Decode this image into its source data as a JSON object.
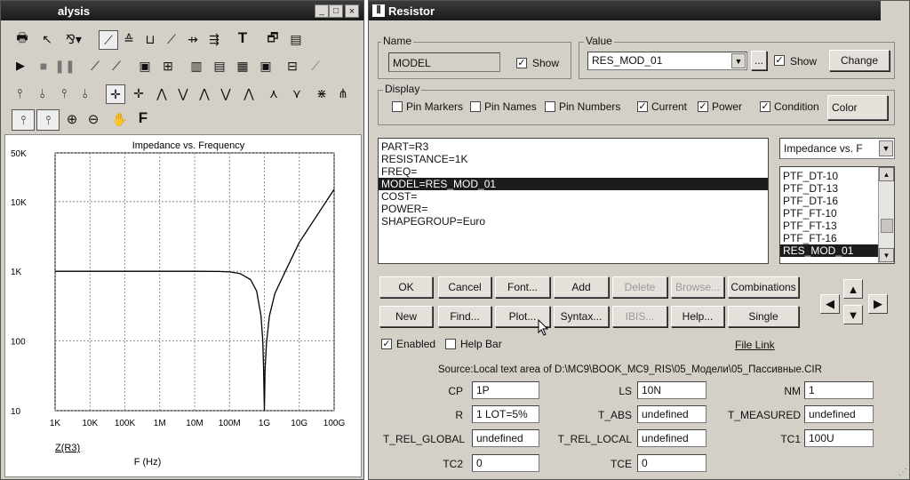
{
  "analysis_window": {
    "title": "alysis",
    "title_buttons": [
      "_",
      "□",
      "×"
    ],
    "chart": {
      "title": "Impedance vs. Frequency",
      "y_ticks": [
        "50K",
        "10K",
        "1K",
        "100",
        "10"
      ],
      "x_ticks": [
        "1K",
        "10K",
        "100K",
        "1M",
        "10M",
        "100M",
        "1G",
        "10G",
        "100G"
      ],
      "xlabel": "F (Hz)",
      "series_label": "Z(R3)"
    }
  },
  "chart_data": {
    "type": "line",
    "title": "Impedance vs. Frequency",
    "xlabel": "F (Hz)",
    "ylabel": "",
    "xscale": "log",
    "yscale": "log",
    "xlim": [
      1000,
      100000000000
    ],
    "ylim": [
      10,
      50000
    ],
    "grid": true,
    "series": [
      {
        "name": "Z(R3)",
        "color": "#000000",
        "x": [
          1000,
          10000,
          100000,
          1000000,
          10000000,
          50000000,
          100000000,
          200000000,
          400000000,
          600000000,
          800000000,
          900000000,
          950000000,
          1000000000,
          1050000000,
          1150000000,
          1400000000,
          2000000000,
          4000000000,
          10000000000,
          30000000000,
          100000000000
        ],
        "y": [
          1000,
          1000,
          1000,
          1000,
          1000,
          995,
          980,
          930,
          760,
          520,
          230,
          100,
          40,
          10,
          40,
          95,
          230,
          480,
          1000,
          2600,
          6000,
          15000
        ]
      }
    ]
  },
  "resistor_dialog": {
    "title": "Resistor",
    "name_group": {
      "title": "Name",
      "value": "MODEL",
      "show_label": "Show",
      "show_checked": "✓"
    },
    "value_group": {
      "title": "Value",
      "value": "RES_MOD_01",
      "ellipsis": "...",
      "show_label": "Show",
      "show_checked": "✓",
      "change_label": "Change"
    },
    "display_group": {
      "title": "Display",
      "items": [
        {
          "label": "Pin Markers",
          "mark": ""
        },
        {
          "label": "Pin Names",
          "mark": ""
        },
        {
          "label": "Pin Numbers",
          "mark": ""
        },
        {
          "label": "Current",
          "mark": "✓"
        },
        {
          "label": "Power",
          "mark": "✓"
        },
        {
          "label": "Condition",
          "mark": "✓"
        }
      ],
      "color_label": "Color"
    },
    "attributes": [
      "PART=R3",
      "RESISTANCE=1K",
      "FREQ=",
      "MODEL=RES_MOD_01",
      "COST=",
      "POWER=",
      "SHAPEGROUP=Euro"
    ],
    "plot_select": "Impedance vs. F",
    "models": [
      "PTF_DT-10",
      "PTF_DT-13",
      "PTF_DT-16",
      "PTF_FT-10",
      "PTF_FT-13",
      "PTF_FT-16",
      "RES_MOD_01"
    ],
    "buttons_row1": [
      "OK",
      "Cancel",
      "Font...",
      "Add",
      "Delete",
      "Browse...",
      "Combinations"
    ],
    "buttons_row2": [
      "New",
      "Find...",
      "Plot...",
      "Syntax...",
      "IBIS...",
      "Help...",
      "Single"
    ],
    "enabled_label": "Enabled",
    "enabled_mark": "✓",
    "helpbar_label": "Help Bar",
    "helpbar_mark": "",
    "file_link": "File Link",
    "source": "Source:Local text area of D:\\MC9\\BOOK_MC9_RIS\\05_Модели\\05_Пассивные.CIR",
    "params": {
      "cp": {
        "label": "CP",
        "value": "1P"
      },
      "ls": {
        "label": "LS",
        "value": "10N"
      },
      "nm": {
        "label": "NM",
        "value": "1"
      },
      "r": {
        "label": "R",
        "value": "1 LOT=5%"
      },
      "t_abs": {
        "label": "T_ABS",
        "value": "undefined"
      },
      "t_measured": {
        "label": "T_MEASURED",
        "value": "undefined"
      },
      "t_rel_global": {
        "label": "T_REL_GLOBAL",
        "value": "undefined"
      },
      "t_rel_local": {
        "label": "T_REL_LOCAL",
        "value": "undefined"
      },
      "tc1": {
        "label": "TC1",
        "value": "100U"
      },
      "tc2": {
        "label": "TC2",
        "value": "0"
      },
      "tce": {
        "label": "TCE",
        "value": "0"
      }
    }
  }
}
